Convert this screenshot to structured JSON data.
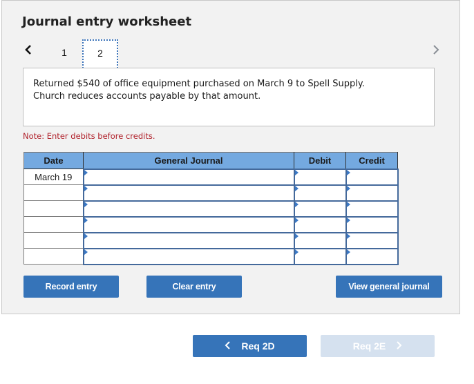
{
  "worksheet": {
    "title": "Journal entry worksheet",
    "pages": [
      {
        "label": "1",
        "active": false
      },
      {
        "label": "2",
        "active": true
      }
    ],
    "description_line1": "Returned $540 of office equipment purchased on March 9 to Spell Supply.",
    "description_line2": "Church reduces accounts payable by that amount.",
    "note": "Note: Enter debits before credits."
  },
  "journal": {
    "headers": {
      "date": "Date",
      "general_journal": "General Journal",
      "debit": "Debit",
      "credit": "Credit"
    },
    "rows": [
      {
        "date": "March 19",
        "account": "",
        "debit": "",
        "credit": ""
      },
      {
        "date": "",
        "account": "",
        "debit": "",
        "credit": ""
      },
      {
        "date": "",
        "account": "",
        "debit": "",
        "credit": ""
      },
      {
        "date": "",
        "account": "",
        "debit": "",
        "credit": ""
      },
      {
        "date": "",
        "account": "",
        "debit": "",
        "credit": ""
      },
      {
        "date": "",
        "account": "",
        "debit": "",
        "credit": ""
      }
    ]
  },
  "buttons": {
    "record": "Record entry",
    "clear": "Clear entry",
    "view": "View general journal"
  },
  "navigation": {
    "prev_label": "Req 2D",
    "next_label": "Req 2E",
    "next_disabled": true
  },
  "colors": {
    "accent": "#3674b9",
    "header_bg": "#74a9e0",
    "note": "#b0202a",
    "disabled": "#d5e1ef"
  }
}
